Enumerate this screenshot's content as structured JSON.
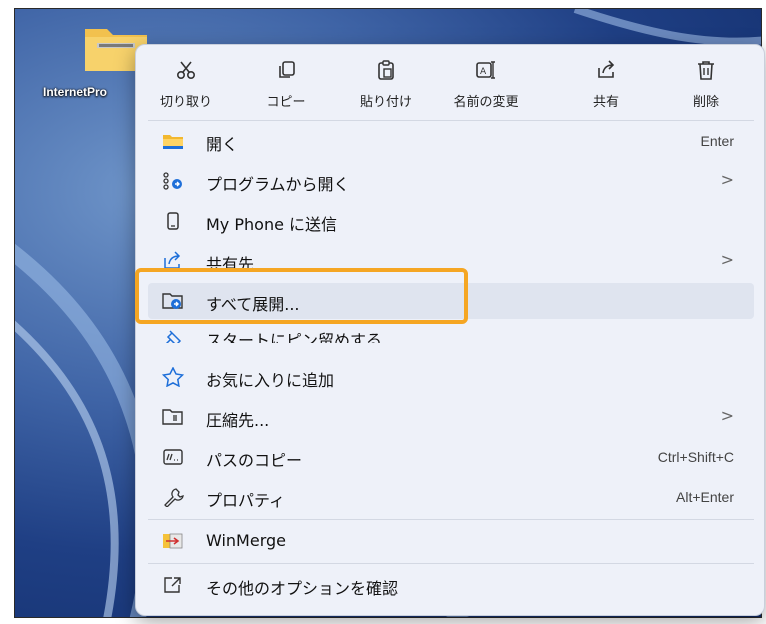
{
  "desktop": {
    "icon_label": "InternetPro"
  },
  "toolbar": [
    {
      "icon": "cut-icon",
      "label": "切り取り"
    },
    {
      "icon": "copy-icon",
      "label": "コピー"
    },
    {
      "icon": "paste-icon",
      "label": "貼り付け"
    },
    {
      "icon": "rename-icon",
      "label": "名前の変更"
    },
    {
      "icon": "share-icon",
      "label": "共有"
    },
    {
      "icon": "delete-icon",
      "label": "削除"
    }
  ],
  "menu": [
    {
      "icon": "folder-icon",
      "label": "開く",
      "shortcut": "Enter"
    },
    {
      "icon": "open-with-icon",
      "label": "プログラムから開く",
      "arrow": ">"
    },
    {
      "icon": "phone-icon",
      "label": "My Phone に送信"
    },
    {
      "icon": "share-icon",
      "label": "共有先",
      "arrow": ">"
    },
    {
      "icon": "extract-icon",
      "label": "すべて展開..."
    },
    {
      "icon": "pin-icon",
      "label": "スタートにピン留めする"
    },
    {
      "icon": "star-icon",
      "label": "お気に入りに追加"
    },
    {
      "icon": "compress-icon",
      "label": "圧縮先...",
      "arrow": ">"
    },
    {
      "icon": "copy-path-icon",
      "label": "パスのコピー",
      "shortcut": "Ctrl+Shift+C"
    },
    {
      "icon": "properties-icon",
      "label": "プロパティ",
      "shortcut": "Alt+Enter"
    },
    {
      "icon": "winmerge-icon",
      "label": "WinMerge"
    },
    {
      "icon": "more-options-icon",
      "label": "その他のオプションを確認"
    }
  ],
  "colors": {
    "highlight": "#f5a623",
    "menu_bg": "#eef1f9",
    "accent": "#1e6fd9"
  }
}
